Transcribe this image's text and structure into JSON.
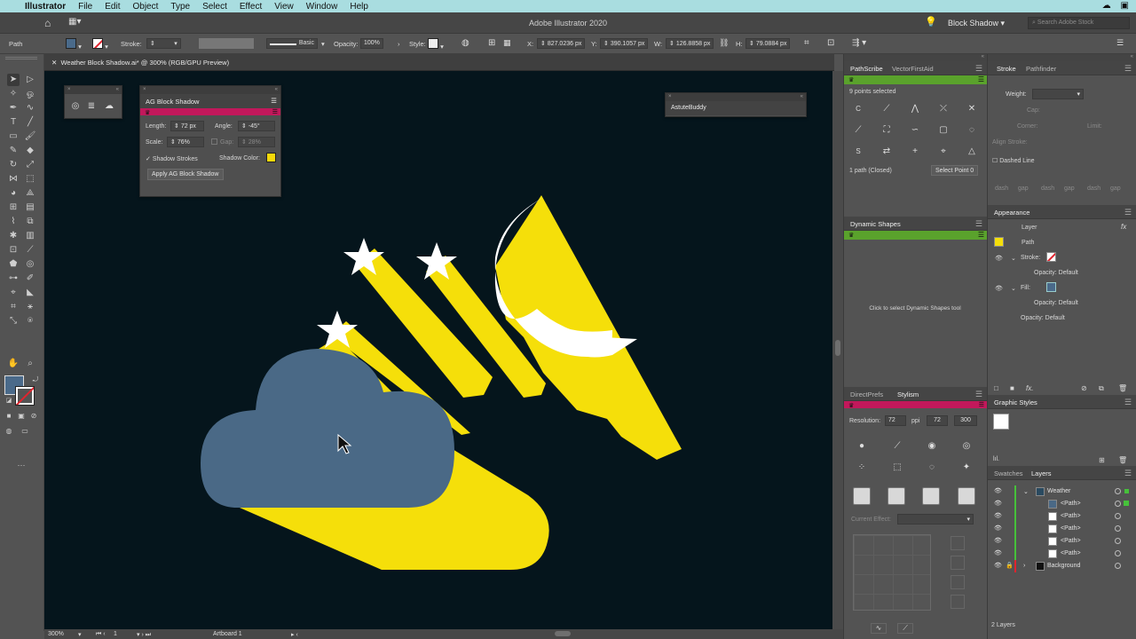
{
  "menubar": {
    "app": "Illustrator",
    "items": [
      "File",
      "Edit",
      "Object",
      "Type",
      "Select",
      "Effect",
      "View",
      "Window",
      "Help"
    ]
  },
  "appbar": {
    "title": "Adobe Illustrator 2020",
    "workspace": "Block Shadow",
    "search_placeholder": "Search Adobe Stock"
  },
  "control": {
    "selection": "Path",
    "stroke_label": "Stroke:",
    "brush": "Basic",
    "opacity_label": "Opacity:",
    "opacity": "100%",
    "style_label": "Style:",
    "x_label": "X:",
    "x": "827.0236 px",
    "y_label": "Y:",
    "y": "390.1057 px",
    "w_label": "W:",
    "w": "126.8858 px",
    "h_label": "H:",
    "h": "79.0884 px",
    "fill_color": "#4a6a8a"
  },
  "document": {
    "tab": "Weather Block Shadow.ai* @ 300% (RGB/GPU Preview)"
  },
  "status": {
    "zoom": "300%",
    "artboard_num": "1",
    "tool": "Artboard 1"
  },
  "ag_panel": {
    "title": "AG Block Shadow",
    "length_label": "Length:",
    "length": "72 px",
    "angle_label": "Angle:",
    "angle": "-45°",
    "scale_label": "Scale:",
    "scale": "76%",
    "gap_label": "Gap:",
    "gap": "28%",
    "shadow_strokes": "Shadow Strokes",
    "shadow_color_label": "Shadow Color:",
    "apply": "Apply AG Block Shadow",
    "shadow_color": "#f5d90a"
  },
  "astute_panel": {
    "title": "AstuteBuddy"
  },
  "pathscribe": {
    "tabs": [
      "PathScribe",
      "VectorFirstAid"
    ],
    "points": "9 points selected",
    "path_info": "1 path (Closed)",
    "select_point": "Select Point 0"
  },
  "dynamic_shapes": {
    "title": "Dynamic Shapes",
    "hint": "Click to select Dynamic Shapes tool"
  },
  "stylism": {
    "tabs": [
      "DirectPrefs",
      "Stylism"
    ],
    "resolution_label": "Resolution:",
    "resolution": "72",
    "unit": "ppi",
    "preset_72": "72",
    "preset_300": "300",
    "current_effect": "Current Effect:"
  },
  "stroke_panel": {
    "tabs": [
      "Stroke",
      "Pathfinder"
    ],
    "weight_label": "Weight:",
    "cap_label": "Cap:",
    "corner_label": "Corner:",
    "limit_label": "Limit:",
    "align_label": "Align Stroke:",
    "dashed": "Dashed Line",
    "dash": "dash",
    "gap": "gap"
  },
  "appearance": {
    "title": "Appearance",
    "layer": "Layer",
    "path": "Path",
    "stroke": "Stroke:",
    "fill": "Fill:",
    "opacity_label": "Opacity:",
    "opacity_value": "Default"
  },
  "graphic_styles": {
    "title": "Graphic Styles"
  },
  "layers": {
    "tabs": [
      "Swatches",
      "Layers"
    ],
    "rows": [
      {
        "name": "Weather"
      },
      {
        "name": "<Path>"
      },
      {
        "name": "<Path>"
      },
      {
        "name": "<Path>"
      },
      {
        "name": "<Path>"
      },
      {
        "name": "<Path>"
      },
      {
        "name": "Background"
      }
    ],
    "count": "2 Layers"
  },
  "colors": {
    "cloud": "#4a6986",
    "shadow": "#f5df0a",
    "canvas": "#05151c",
    "star": "#ffffff"
  }
}
